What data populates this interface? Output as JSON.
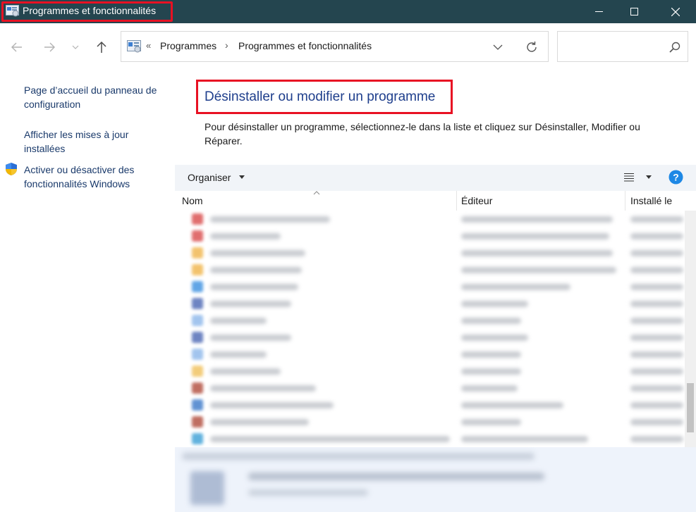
{
  "window": {
    "title": "Programmes et fonctionnalités"
  },
  "address_bar": {
    "overflow": "«",
    "crumbs": [
      "Programmes",
      "Programmes et fonctionnalités"
    ],
    "separator": "›",
    "search_placeholder": ""
  },
  "left_pane": {
    "home_link": "Page d’accueil du panneau de configuration",
    "updates_link": "Afficher les mises à jour installées",
    "features_link": "Activer ou désactiver des fonctionnalités Windows"
  },
  "main": {
    "heading": "Désinstaller ou modifier un programme",
    "description": "Pour désinstaller un programme, sélectionnez-le dans la liste et cliquez sur Désinstaller, Modifier ou Réparer."
  },
  "toolbar": {
    "organise_label": "Organiser"
  },
  "columns": {
    "name": "Nom",
    "publisher": "Éditeur",
    "installed": "Installé le"
  },
  "colors": {
    "titlebar": "#24454f",
    "highlight": "#e81123",
    "link": "#1a3a6b",
    "heading": "#1e3e8c",
    "toolbar_bg": "#f1f4f8",
    "help": "#1e88e5"
  }
}
